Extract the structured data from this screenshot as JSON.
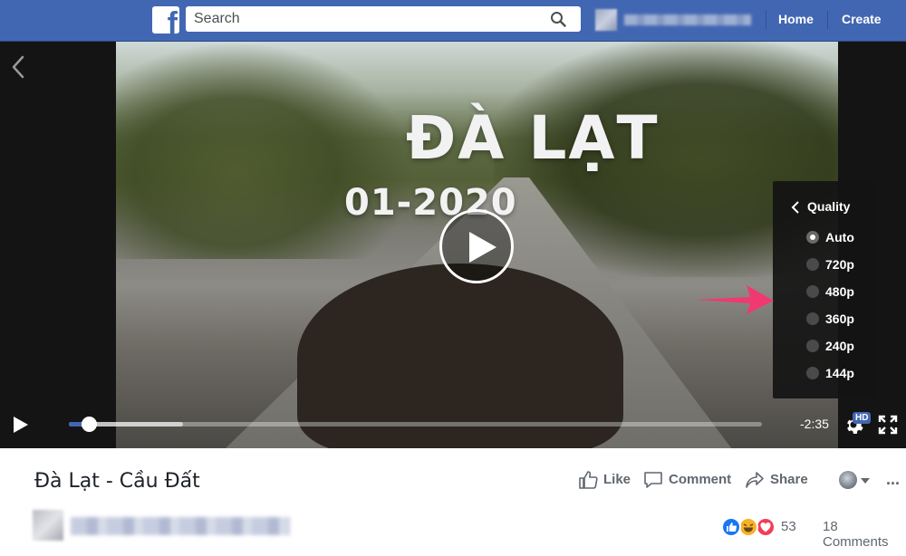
{
  "topbar": {
    "logo_letter": "f",
    "search": {
      "placeholder": "Search",
      "value": ""
    },
    "nav": {
      "home": "Home",
      "create": "Create"
    },
    "brand_color": "#4267b2"
  },
  "video": {
    "overlay_title": "ĐÀ LẠT",
    "overlay_date": "01-2020",
    "time_remaining": "-2:35",
    "progress_played": 0.02,
    "progress_buffered": 0.165,
    "hd_badge": "HD"
  },
  "quality_menu": {
    "title": "Quality",
    "options": [
      {
        "label": "Auto",
        "selected": true
      },
      {
        "label": "720p",
        "selected": false
      },
      {
        "label": "480p",
        "selected": false
      },
      {
        "label": "360p",
        "selected": false
      },
      {
        "label": "240p",
        "selected": false
      },
      {
        "label": "144p",
        "selected": false
      }
    ],
    "highlight_arrow_color": "#f0396f"
  },
  "post": {
    "title": "Đà Lạt - Cầu Đất",
    "actions": {
      "like": "Like",
      "comment": "Comment",
      "share": "Share"
    },
    "more": "...",
    "reaction_count": "53",
    "comments_count": "18 Comments"
  }
}
